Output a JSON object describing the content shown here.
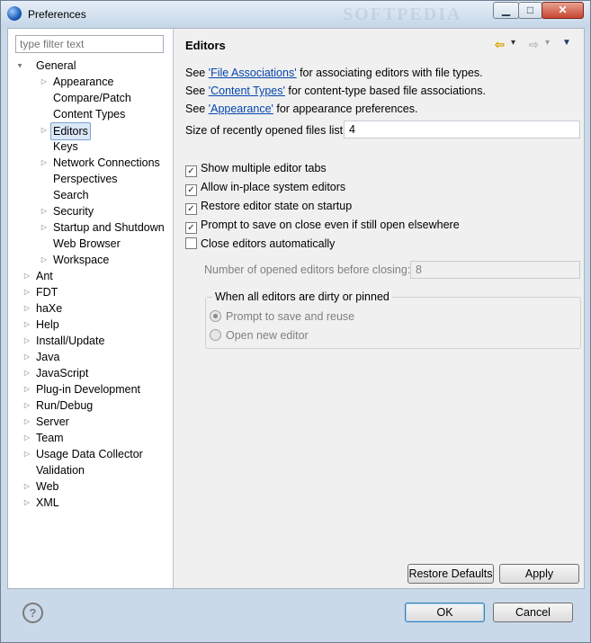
{
  "window": {
    "title": "Preferences",
    "watermark": "SOFTPEDIA"
  },
  "filter": {
    "placeholder": "type filter text"
  },
  "tree": {
    "general": {
      "label": "General",
      "twisty": "▲"
    },
    "general_children": [
      {
        "label": "Appearance",
        "twisty": "▷"
      },
      {
        "label": "Compare/Patch",
        "twisty": ""
      },
      {
        "label": "Content Types",
        "twisty": ""
      },
      {
        "label": "Editors",
        "twisty": "▷",
        "selected": true
      },
      {
        "label": "Keys",
        "twisty": ""
      },
      {
        "label": "Network Connections",
        "twisty": "▷"
      },
      {
        "label": "Perspectives",
        "twisty": ""
      },
      {
        "label": "Search",
        "twisty": ""
      },
      {
        "label": "Security",
        "twisty": "▷"
      },
      {
        "label": "Startup and Shutdown",
        "twisty": "▷"
      },
      {
        "label": "Web Browser",
        "twisty": ""
      },
      {
        "label": "Workspace",
        "twisty": "▷"
      }
    ],
    "top_level": [
      {
        "label": "Ant",
        "twisty": "▷"
      },
      {
        "label": "FDT",
        "twisty": "▷"
      },
      {
        "label": "haXe",
        "twisty": "▷"
      },
      {
        "label": "Help",
        "twisty": "▷"
      },
      {
        "label": "Install/Update",
        "twisty": "▷"
      },
      {
        "label": "Java",
        "twisty": "▷"
      },
      {
        "label": "JavaScript",
        "twisty": "▷"
      },
      {
        "label": "Plug-in Development",
        "twisty": "▷"
      },
      {
        "label": "Run/Debug",
        "twisty": "▷"
      },
      {
        "label": "Server",
        "twisty": "▷"
      },
      {
        "label": "Team",
        "twisty": "▷"
      },
      {
        "label": "Usage Data Collector",
        "twisty": "▷"
      },
      {
        "label": "Validation",
        "twisty": ""
      },
      {
        "label": "Web",
        "twisty": "▷"
      },
      {
        "label": "XML",
        "twisty": "▷"
      }
    ]
  },
  "page": {
    "title": "Editors",
    "nav": {
      "back": "⇦",
      "back_menu": "▾",
      "forward": "⇨",
      "forward_menu": "▾",
      "view_menu": "▼"
    },
    "links": [
      {
        "pre": "See ",
        "link": "'File Associations'",
        "post": " for associating editors with file types."
      },
      {
        "pre": "See ",
        "link": "'Content Types'",
        "post": " for content-type based file associations."
      },
      {
        "pre": "See ",
        "link": "'Appearance'",
        "post": " for appearance preferences."
      }
    ],
    "recent_files": {
      "label": "Size of recently opened files list:",
      "value": "4"
    },
    "checkboxes": [
      {
        "label": "Show multiple editor tabs",
        "checked": true
      },
      {
        "label": "Allow in-place system editors",
        "checked": true
      },
      {
        "label": "Restore editor state on startup",
        "checked": true
      },
      {
        "label": "Prompt to save on close even if still open elsewhere",
        "checked": true
      },
      {
        "label": "Close editors automatically",
        "checked": false
      }
    ],
    "opened_editors": {
      "label": "Number of opened editors before closing:",
      "value": "8"
    },
    "dirty_group": {
      "label": "When all editors are dirty or pinned",
      "options": [
        {
          "label": "Prompt to save and reuse",
          "selected": true
        },
        {
          "label": "Open new editor",
          "selected": false
        }
      ]
    },
    "buttons": {
      "restore_defaults": "Restore Defaults",
      "apply": "Apply"
    }
  },
  "footer": {
    "help": "?",
    "ok": "OK",
    "cancel": "Cancel"
  },
  "icons": {
    "check": "✓",
    "minimize": "▁",
    "maximize": "□",
    "close": "✕"
  }
}
